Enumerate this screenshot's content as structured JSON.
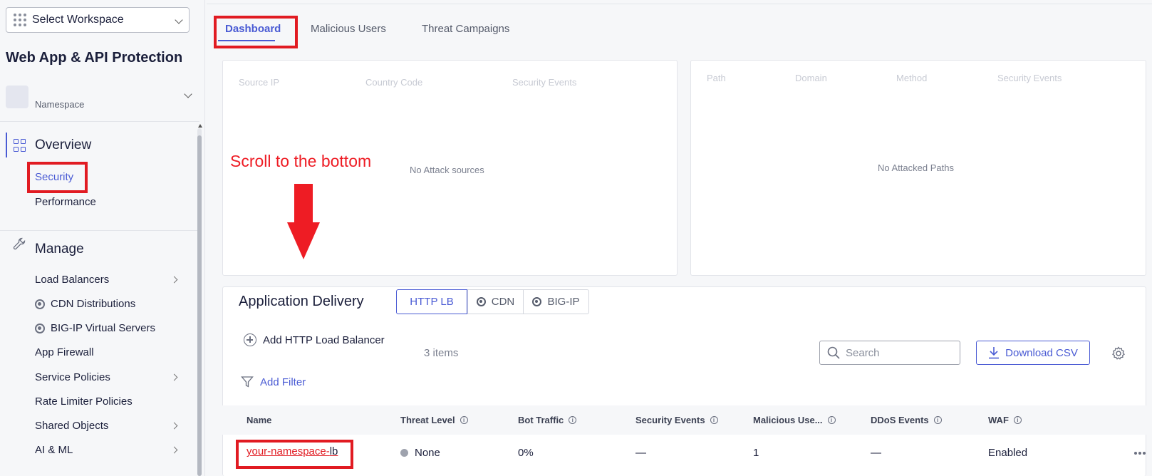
{
  "sidebar": {
    "workspace_select": {
      "label": "Select Workspace",
      "icon": "grid-dots-icon"
    },
    "app_title": "Web App & API Protection",
    "namespace": {
      "label": "Namespace"
    },
    "overview": {
      "heading": "Overview",
      "items": [
        {
          "label": "Security",
          "active": true
        },
        {
          "label": "Performance",
          "active": false
        }
      ]
    },
    "manage": {
      "heading": "Manage",
      "items": [
        {
          "label": "Load Balancers",
          "has_children": true
        },
        {
          "label": "CDN Distributions",
          "icon": "ring-dot-icon"
        },
        {
          "label": "BIG-IP Virtual Servers",
          "icon": "ring-dot-icon"
        },
        {
          "label": "App Firewall"
        },
        {
          "label": "Service Policies",
          "has_children": true
        },
        {
          "label": "Rate Limiter Policies"
        },
        {
          "label": "Shared Objects",
          "has_children": true
        },
        {
          "label": "AI & ML",
          "has_children": true
        }
      ]
    }
  },
  "tabs": [
    {
      "label": "Dashboard",
      "active": true
    },
    {
      "label": "Malicious Users",
      "active": false
    },
    {
      "label": "Threat Campaigns",
      "active": false
    }
  ],
  "attack_sources_panel": {
    "columns": [
      "Source IP",
      "Country Code",
      "Security Events"
    ],
    "empty_message": "No Attack sources"
  },
  "attacked_paths_panel": {
    "columns": [
      "Path",
      "Domain",
      "Method",
      "Security Events"
    ],
    "empty_message": "No Attacked Paths"
  },
  "annotation": {
    "text": "Scroll to the bottom",
    "color": "#ee1c24"
  },
  "app_delivery": {
    "title": "Application Delivery",
    "segments": [
      {
        "label": "HTTP LB",
        "active": true
      },
      {
        "label": "CDN",
        "active": false,
        "icon": "ring-dot-icon"
      },
      {
        "label": "BIG-IP",
        "active": false,
        "icon": "ring-dot-icon"
      }
    ],
    "add_button": "Add HTTP Load Balancer",
    "items_count": "3 items",
    "search_placeholder": "Search",
    "download_button": "Download CSV",
    "add_filter": "Add Filter",
    "table": {
      "columns": [
        "Name",
        "Threat Level",
        "Bot Traffic",
        "Security Events",
        "Malicious Use...",
        "DDoS Events",
        "WAF"
      ],
      "rows": [
        {
          "name_highlight": "your-namespace-",
          "name_rest": "lb",
          "threat_level": "None",
          "bot_traffic": "0%",
          "security_events": "—",
          "malicious_users": "1",
          "ddos_events": "—",
          "waf": "Enabled"
        }
      ]
    }
  },
  "colors": {
    "accent": "#4a5bd4",
    "highlight_box": "#e11b22"
  }
}
